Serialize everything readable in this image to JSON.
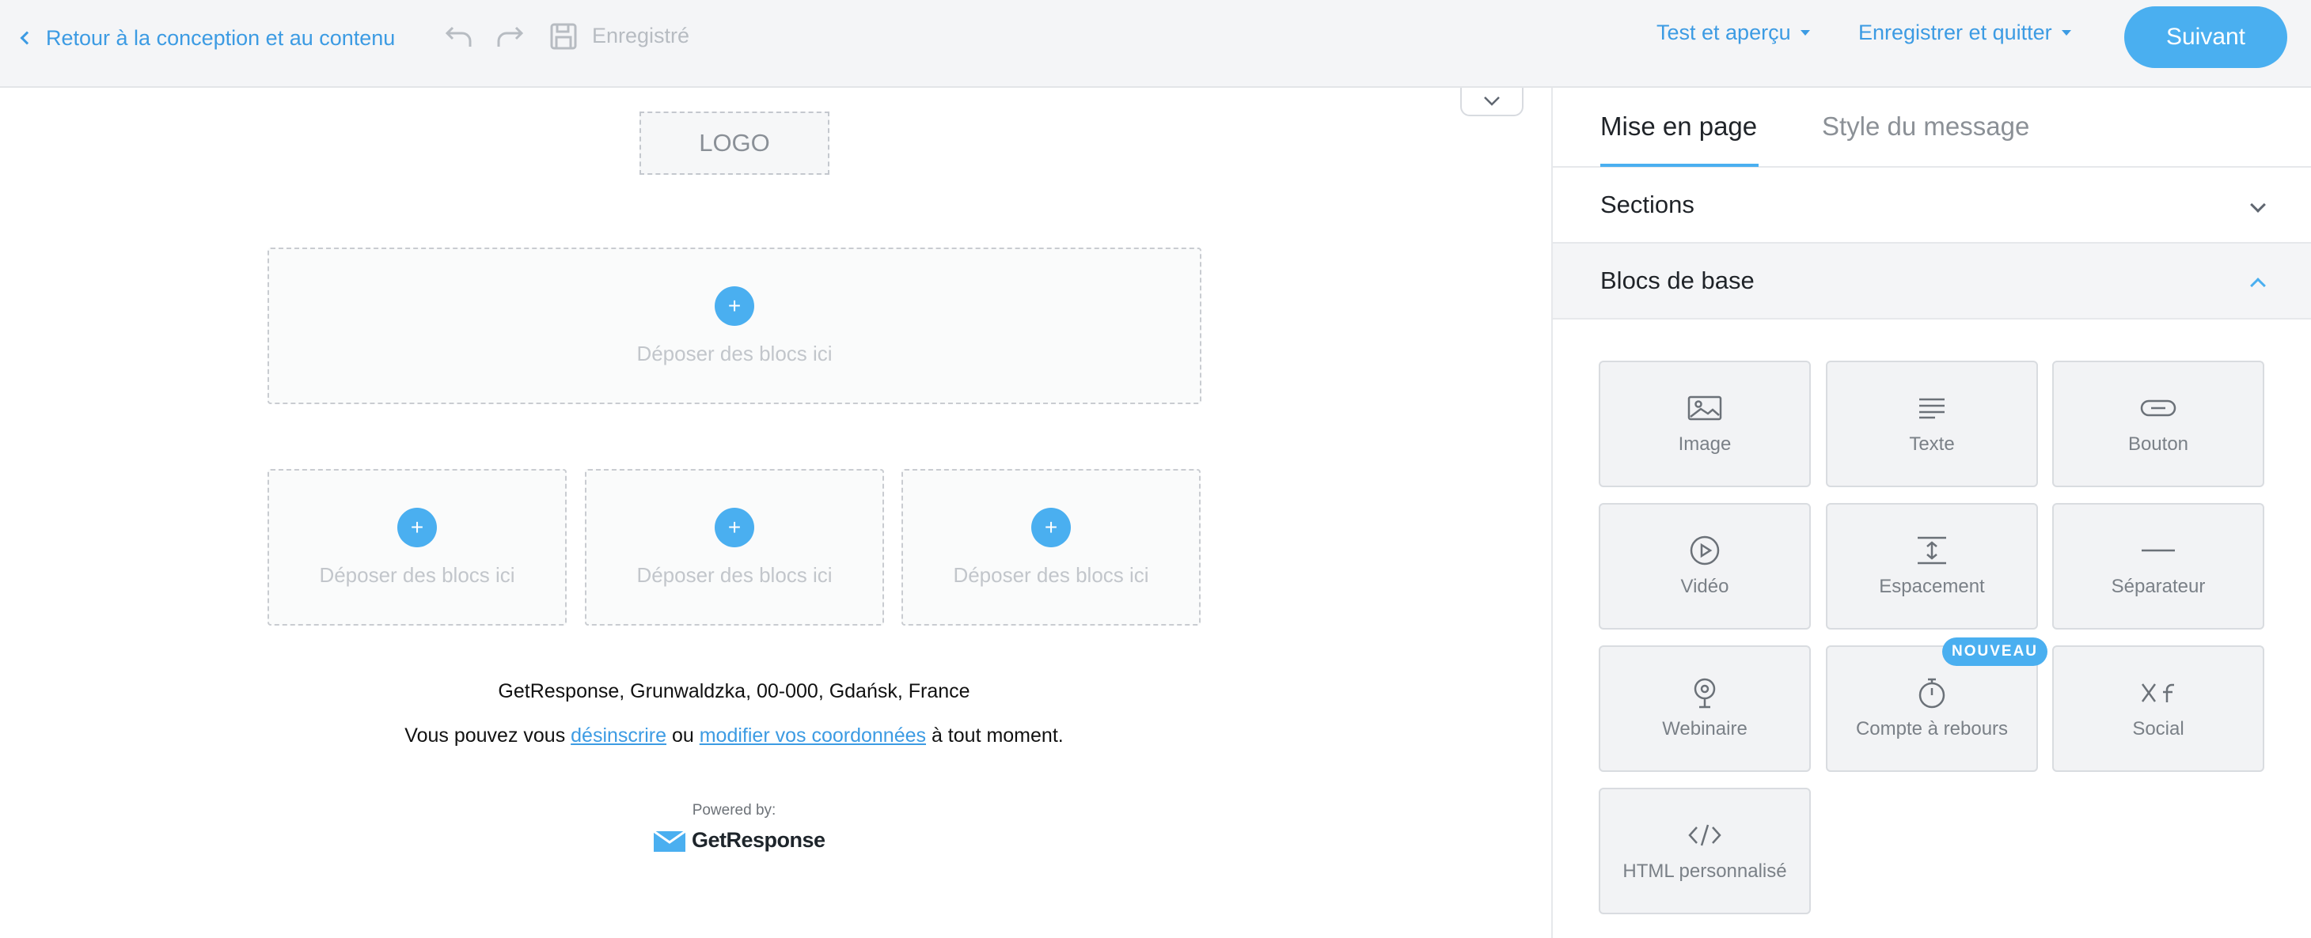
{
  "topbar": {
    "back_label": "Retour à la conception et au contenu",
    "saved_label": "Enregistré",
    "test_menu": "Test et aperçu",
    "save_quit_menu": "Enregistrer et quitter",
    "next_button": "Suivant",
    "accent_color": "#4aaff0"
  },
  "canvas": {
    "logo_placeholder": "LOGO",
    "drop_label": "Déposer des blocs ici",
    "plus": "+",
    "footer": {
      "address": "GetResponse, Grunwaldzka, 00-000, Gdańsk, France",
      "text_before": "Vous pouvez vous ",
      "unsubscribe_link": "désinscrire",
      "text_middle": " ou ",
      "update_link": "modifier vos coordonnées",
      "text_after": " à tout moment.",
      "powered_by": "Powered by:",
      "brand": "GetResponse"
    }
  },
  "panel": {
    "tabs": [
      "Mise en page",
      "Style du message"
    ],
    "sections_label": "Sections",
    "basic_blocks_label": "Blocs de base",
    "new_badge": "NOUVEAU",
    "blocks": [
      {
        "label": "Image",
        "icon": "image-icon"
      },
      {
        "label": "Texte",
        "icon": "text-icon"
      },
      {
        "label": "Bouton",
        "icon": "button-icon"
      },
      {
        "label": "Vidéo",
        "icon": "video-icon"
      },
      {
        "label": "Espacement",
        "icon": "spacing-icon"
      },
      {
        "label": "Séparateur",
        "icon": "separator-icon"
      },
      {
        "label": "Webinaire",
        "icon": "webinar-icon"
      },
      {
        "label": "Compte à rebours",
        "icon": "countdown-icon"
      },
      {
        "label": "Social",
        "icon": "social-icon"
      },
      {
        "label": "HTML personnalisé",
        "icon": "code-icon"
      }
    ]
  }
}
